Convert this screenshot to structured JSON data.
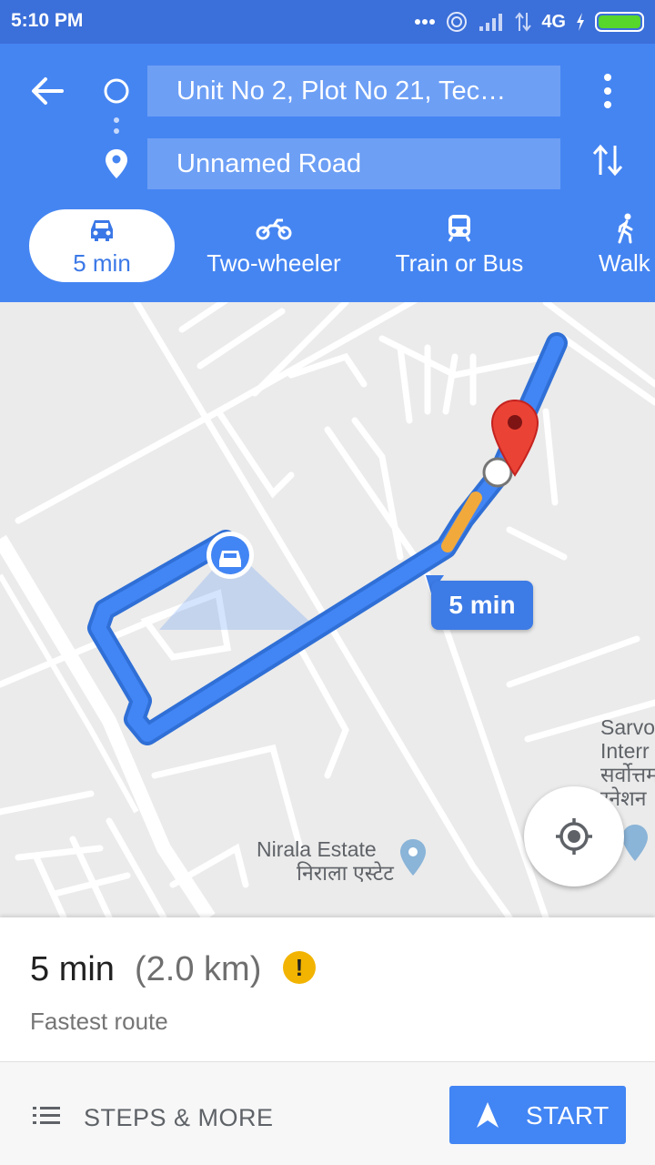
{
  "status_bar": {
    "time": "5:10 PM",
    "network": "4G"
  },
  "header": {
    "origin": "Unit No 2, Plot No 21, Tec…",
    "destination": "Unnamed Road"
  },
  "modes": [
    {
      "label": "5 min",
      "icon": "car-icon",
      "selected": true
    },
    {
      "label": "Two-wheeler",
      "icon": "motorcycle-icon"
    },
    {
      "label": "Train or Bus",
      "icon": "train-icon"
    },
    {
      "label": "Walk",
      "icon": "walk-icon"
    }
  ],
  "map": {
    "eta_bubble": "5 min",
    "poi_nirala_en": "Nirala Estate",
    "poi_nirala_hi": "निराला एस्टेट",
    "poi_sarvo_line1": "Sarvo",
    "poi_sarvo_line2": "Interr",
    "poi_sarvo_line3": "सर्वोत्तम",
    "poi_sarvo_line4": "रनेशन",
    "colors": {
      "route": "#4285f4",
      "traffic": "#f2a93b",
      "pin": "#ea4335"
    }
  },
  "summary": {
    "duration": "5 min",
    "distance": "(2.0 km)",
    "warning": "!",
    "subtitle": "Fastest route"
  },
  "footer": {
    "steps_label": "STEPS & MORE",
    "start_label": "START"
  },
  "accent_colors": {
    "header": "#4585f2",
    "status_bar": "#3b6fd9",
    "button": "#4285f4"
  }
}
